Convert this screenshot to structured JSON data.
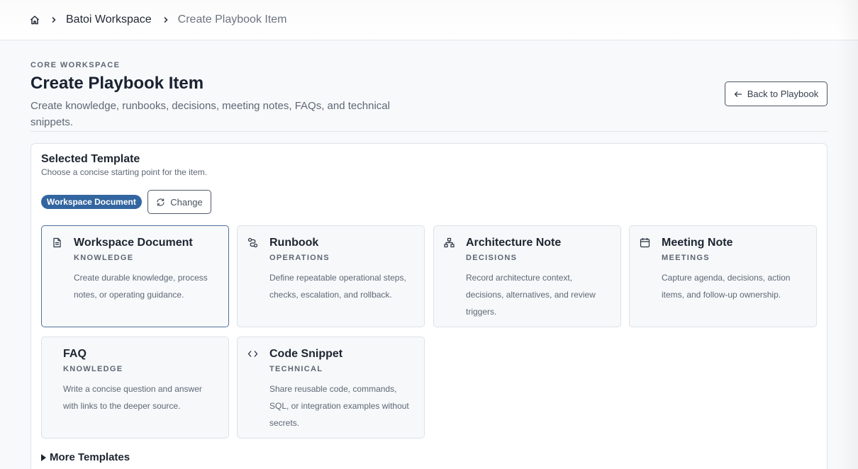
{
  "breadcrumb": {
    "home_icon": "home-icon",
    "items": [
      "Batoi Workspace",
      "Create Playbook Item"
    ]
  },
  "header": {
    "eyebrow": "CORE WORKSPACE",
    "title": "Create Playbook Item",
    "description": "Create knowledge, runbooks, decisions, meeting notes, FAQs, and technical snippets.",
    "back_label": "Back to Playbook"
  },
  "template_panel": {
    "title": "Selected Template",
    "subtitle": "Choose a concise starting point for the item.",
    "selected_badge": "Workspace Document",
    "change_label": "Change",
    "more_label": "More Templates"
  },
  "templates": [
    {
      "title": "Workspace Document",
      "category": "KNOWLEDGE",
      "description": "Create durable knowledge, process notes, or operating guidance.",
      "icon": "document-icon",
      "selected": true
    },
    {
      "title": "Runbook",
      "category": "OPERATIONS",
      "description": "Define repeatable operational steps, checks, escalation, and rollback.",
      "icon": "route-icon",
      "selected": false
    },
    {
      "title": "Architecture Note",
      "category": "DECISIONS",
      "description": "Record architecture context, decisions, alternatives, and review triggers.",
      "icon": "hierarchy-icon",
      "selected": false
    },
    {
      "title": "Meeting Note",
      "category": "MEETINGS",
      "description": "Capture agenda, decisions, action items, and follow-up ownership.",
      "icon": "calendar-icon",
      "selected": false
    },
    {
      "title": "FAQ",
      "category": "KNOWLEDGE",
      "description": "Write a concise question and answer with links to the deeper source.",
      "icon": "",
      "selected": false
    },
    {
      "title": "Code Snippet",
      "category": "TECHNICAL",
      "description": "Share reusable code, commands, SQL, or integration examples without secrets.",
      "icon": "code-icon",
      "selected": false
    }
  ],
  "colors": {
    "accent": "#3366a0",
    "selected_border": "#4f7297"
  }
}
